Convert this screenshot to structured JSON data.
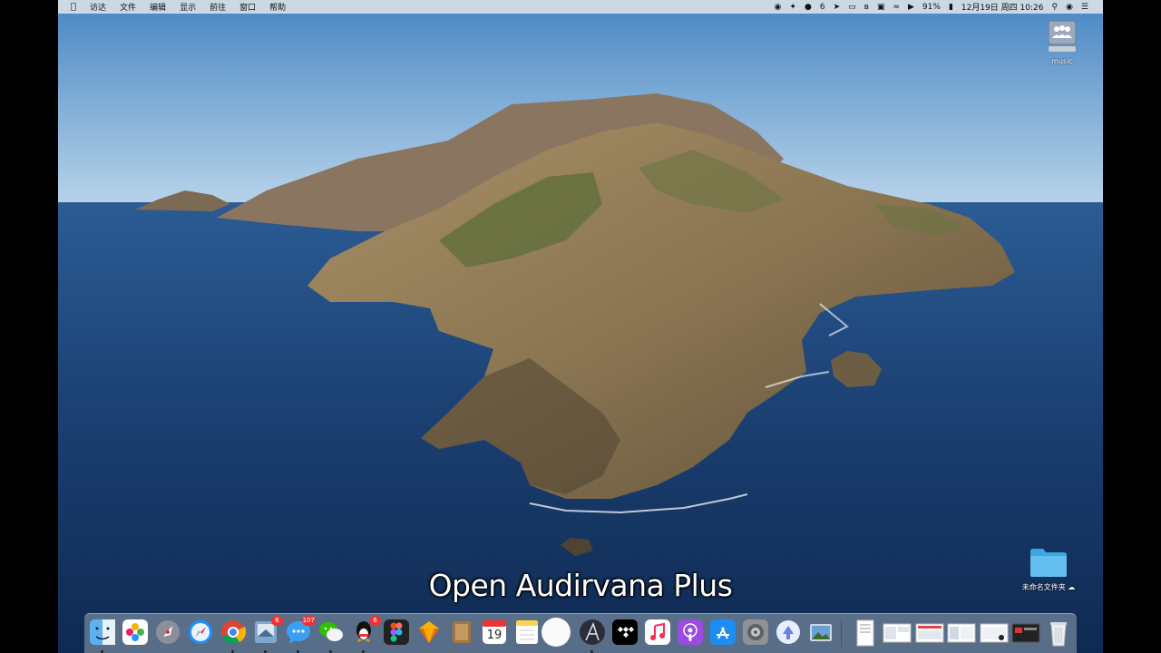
{
  "menubar": {
    "apple_icon": "apple-icon",
    "items": [
      "访达",
      "文件",
      "编辑",
      "显示",
      "前往",
      "窗口",
      "帮助"
    ],
    "status": {
      "badge_count": "6",
      "battery": "91%",
      "datetime": "12月19日 周四  10:26"
    }
  },
  "desktop": {
    "drive_label": "music",
    "folder_label": "未命名文件夹"
  },
  "caption": "Open Audirvana Plus",
  "dock": {
    "apps": [
      {
        "name": "finder",
        "running": true
      },
      {
        "name": "photos",
        "running": false
      },
      {
        "name": "launchpad",
        "running": false
      },
      {
        "name": "safari",
        "running": false
      },
      {
        "name": "chrome",
        "running": true
      },
      {
        "name": "mail-preview",
        "badge": "6",
        "running": true
      },
      {
        "name": "messages",
        "badge": "107",
        "running": true
      },
      {
        "name": "wechat",
        "running": true
      },
      {
        "name": "qq",
        "badge": "6",
        "running": true
      },
      {
        "name": "figma",
        "running": false
      },
      {
        "name": "sketch",
        "running": false
      },
      {
        "name": "notefile",
        "running": false
      },
      {
        "name": "calendar",
        "date": "19",
        "running": false
      },
      {
        "name": "notes",
        "running": false
      },
      {
        "name": "blank-app",
        "running": false
      },
      {
        "name": "audirvana",
        "running": true
      },
      {
        "name": "tidal",
        "running": false
      },
      {
        "name": "music",
        "running": false
      },
      {
        "name": "podcasts",
        "running": false
      },
      {
        "name": "app-store",
        "running": false
      },
      {
        "name": "system-preferences",
        "running": false
      },
      {
        "name": "feedback",
        "running": false
      },
      {
        "name": "preview",
        "running": false
      }
    ]
  },
  "colors": {
    "sky": "#5b93c8",
    "ocean": "#183a68",
    "accent_blue": "#1a8cff"
  }
}
